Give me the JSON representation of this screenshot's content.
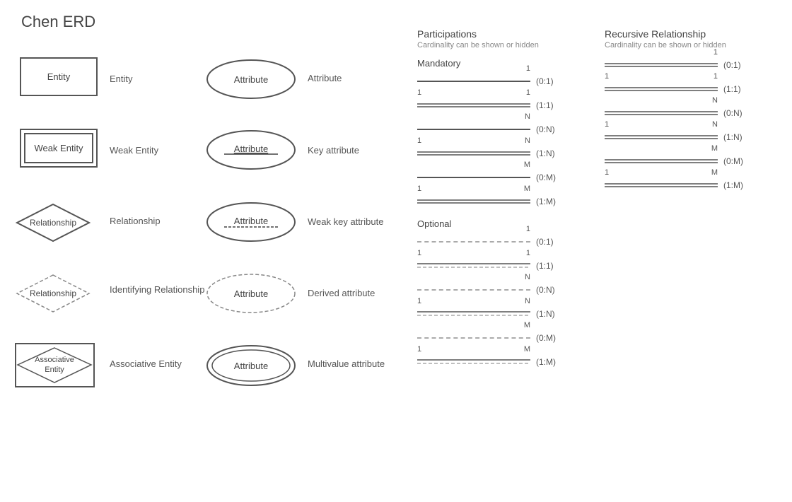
{
  "title": "Chen ERD",
  "leftPanel": {
    "entities": [
      {
        "type": "entity",
        "shapeLabel": "Entity",
        "label": "Entity"
      },
      {
        "type": "weak-entity",
        "shapeLabel": "Weak Entity",
        "label": "Weak Entity"
      },
      {
        "type": "relationship",
        "shapeLabel": "Relationship",
        "label": "Relationship"
      },
      {
        "type": "identifying-relationship",
        "shapeLabel": "Relationship",
        "label": "Identifying Relationship"
      },
      {
        "type": "associative-entity",
        "shapeLabel1": "Associative",
        "shapeLabel2": "Entity",
        "label": "Associative Entity"
      }
    ],
    "attributes": [
      {
        "type": "normal",
        "shapeLabel": "Attribute",
        "label": "Attribute"
      },
      {
        "type": "key",
        "shapeLabel": "Attribute",
        "underline": true,
        "label": "Key attribute"
      },
      {
        "type": "weak-key",
        "shapeLabel": "Attribute",
        "underline": true,
        "label": "Weak key attribute"
      },
      {
        "type": "derived",
        "shapeLabel": "Attribute",
        "dashed": true,
        "label": "Derived attribute"
      },
      {
        "type": "multivalue",
        "shapeLabel": "Attribute",
        "double": true,
        "label": "Multivalue attribute"
      }
    ]
  },
  "participations": {
    "title": "Participations",
    "subtitle": "Cardinality can be shown or hidden",
    "mandatory": {
      "label": "Mandatory",
      "rows": [
        {
          "leftNum": "",
          "rightNum": "1",
          "cardinality": "(0:1)",
          "lineType": "solid"
        },
        {
          "leftNum": "1",
          "rightNum": "1",
          "cardinality": "(1:1)",
          "lineType": "solid-double"
        },
        {
          "leftNum": "",
          "rightNum": "N",
          "cardinality": "(0:N)",
          "lineType": "solid"
        },
        {
          "leftNum": "1",
          "rightNum": "N",
          "cardinality": "(1:N)",
          "lineType": "solid-double"
        },
        {
          "leftNum": "",
          "rightNum": "M",
          "cardinality": "(0:M)",
          "lineType": "solid"
        },
        {
          "leftNum": "1",
          "rightNum": "M",
          "cardinality": "(1:M)",
          "lineType": "solid-double"
        }
      ]
    },
    "optional": {
      "label": "Optional",
      "rows": [
        {
          "leftNum": "",
          "rightNum": "1",
          "cardinality": "(0:1)",
          "lineType": "dashed"
        },
        {
          "leftNum": "1",
          "rightNum": "1",
          "cardinality": "(1:1)",
          "lineType": "dashed-mixed"
        },
        {
          "leftNum": "",
          "rightNum": "N",
          "cardinality": "(0:N)",
          "lineType": "dashed"
        },
        {
          "leftNum": "1",
          "rightNum": "N",
          "cardinality": "(1:N)",
          "lineType": "dashed-mixed"
        },
        {
          "leftNum": "",
          "rightNum": "M",
          "cardinality": "(0:M)",
          "lineType": "dashed"
        },
        {
          "leftNum": "1",
          "rightNum": "M",
          "cardinality": "(1:M)",
          "lineType": "dashed-mixed"
        }
      ]
    }
  },
  "recursive": {
    "title": "Recursive Relationship",
    "subtitle": "Cardinality can be shown or hidden",
    "rows": [
      {
        "leftNum": "",
        "rightNum": "1",
        "cardinality": "(0:1)",
        "lineType": "solid-double"
      },
      {
        "leftNum": "1",
        "rightNum": "1",
        "cardinality": "(1:1)",
        "lineType": "solid-double"
      },
      {
        "leftNum": "",
        "rightNum": "N",
        "cardinality": "(0:N)",
        "lineType": "solid-double"
      },
      {
        "leftNum": "1",
        "rightNum": "N",
        "cardinality": "(1:N)",
        "lineType": "solid-double"
      },
      {
        "leftNum": "",
        "rightNum": "M",
        "cardinality": "(0:M)",
        "lineType": "solid-double"
      },
      {
        "leftNum": "1",
        "rightNum": "M",
        "cardinality": "(1:M)",
        "lineType": "solid-double"
      }
    ]
  }
}
